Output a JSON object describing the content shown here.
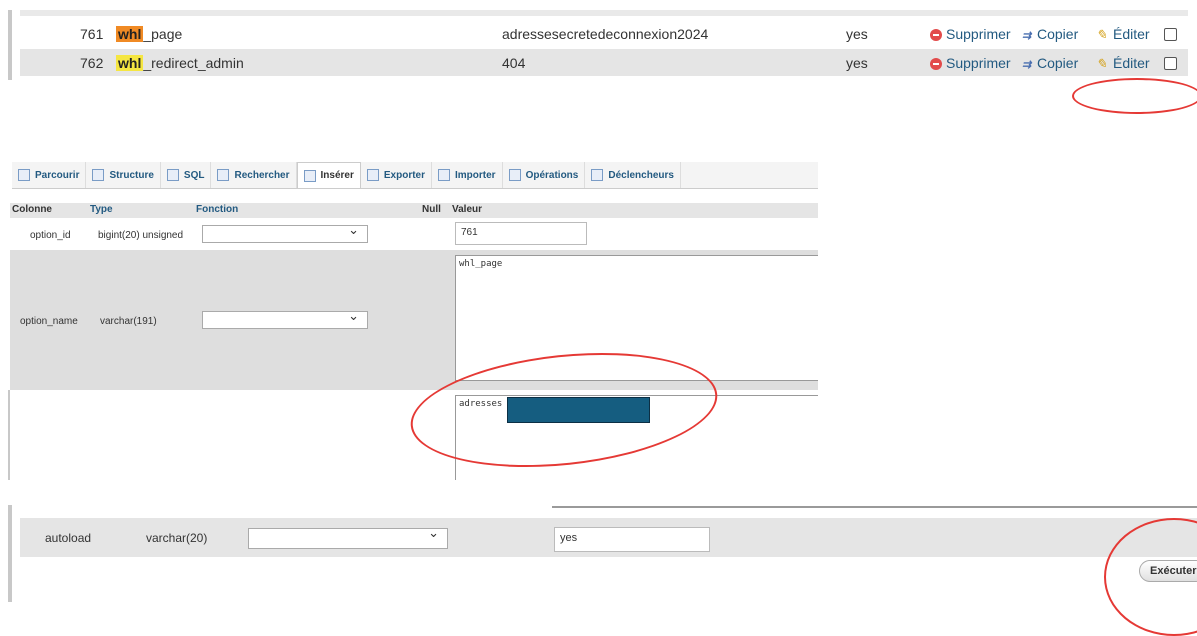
{
  "rows": [
    {
      "id": "761",
      "name_hl": "whl",
      "name_rest": "_page",
      "value": "adressesecretedeconnexion2024",
      "autoload": "yes",
      "hl_color": "#f08a24"
    },
    {
      "id": "762",
      "name_hl": "whl",
      "name_rest": "_redirect_admin",
      "value": "404",
      "autoload": "yes",
      "hl_color": "#f5e642"
    }
  ],
  "row_actions": {
    "delete": "Supprimer",
    "copy": "Copier",
    "edit": "Éditer"
  },
  "tabs": [
    {
      "label": "Parcourir",
      "icon": "browse-icon"
    },
    {
      "label": "Structure",
      "icon": "structure-icon"
    },
    {
      "label": "SQL",
      "icon": "sql-icon"
    },
    {
      "label": "Rechercher",
      "icon": "search-icon"
    },
    {
      "label": "Insérer",
      "icon": "insert-icon"
    },
    {
      "label": "Exporter",
      "icon": "export-icon"
    },
    {
      "label": "Importer",
      "icon": "import-icon"
    },
    {
      "label": "Opérations",
      "icon": "wrench-icon"
    },
    {
      "label": "Déclencheurs",
      "icon": "trigger-icon"
    }
  ],
  "active_tab": "Insérer",
  "columns": {
    "col": "Colonne",
    "type": "Type",
    "func": "Fonction",
    "null": "Null",
    "value": "Valeur"
  },
  "fields": {
    "option_id": {
      "name": "option_id",
      "type": "bigint(20) unsigned",
      "value": "761"
    },
    "option_name": {
      "name": "option_name",
      "type": "varchar(191)",
      "value": "whl_page"
    },
    "option_value": {
      "value": "adresses"
    },
    "autoload": {
      "name": "autoload",
      "type": "varchar(20)",
      "value": "yes"
    }
  },
  "execute_label": "Exécuter",
  "colors": {
    "annotation": "#e53935",
    "redaction": "#155d80",
    "link": "#235a81"
  }
}
